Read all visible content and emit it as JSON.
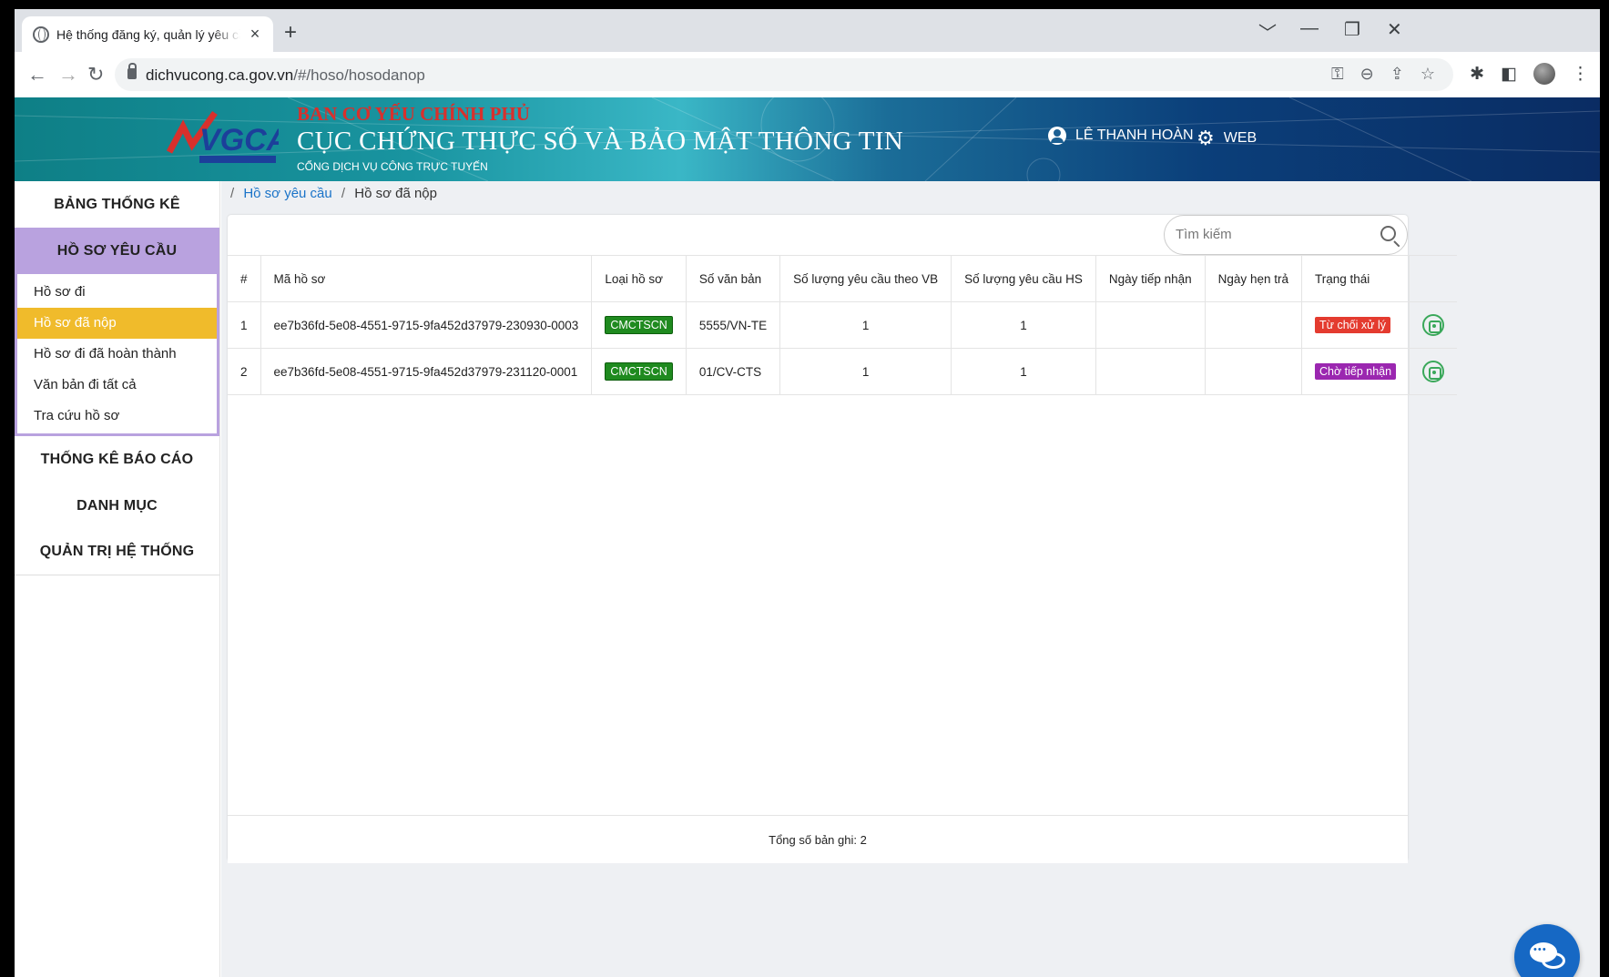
{
  "browser": {
    "tab_title": "Hệ thống đăng ký, quản lý yêu cầu",
    "tab_close": "×",
    "new_tab": "+",
    "url_host": "dichvucong.ca.gov.vn",
    "url_path": "/#/hoso/hosodanop",
    "win_controls": [
      "﹀",
      "—",
      "❐",
      "✕"
    ]
  },
  "header": {
    "logo_text": "VGCA",
    "org_top": "BAN CƠ YẾU CHÍNH PHỦ",
    "org_main": "CỤC CHỨNG THỰC SỐ VÀ BẢO MẬT THÔNG TIN",
    "org_sub": "CỔNG DỊCH VỤ CÔNG TRỰC TUYẾN",
    "user_name": "LÊ THANH HOÀN",
    "web_label": "WEB"
  },
  "sidebar": {
    "dashboard": "BẢNG THỐNG KÊ",
    "requests": "HỒ SƠ YÊU CẦU",
    "items": [
      "Hồ sơ đi",
      "Hồ sơ đã nộp",
      "Hồ sơ đi đã hoàn thành",
      "Văn bản đi tất cả",
      "Tra cứu hồ sơ"
    ],
    "reports": "THỐNG KÊ BÁO CÁO",
    "catalog": "DANH MỤC",
    "admin": "QUẢN TRỊ HỆ THỐNG"
  },
  "breadcrumb": {
    "sep": "/",
    "parent": "Hồ sơ yêu cầu",
    "current": "Hồ sơ đã nộp"
  },
  "search": {
    "placeholder": "Tìm kiếm"
  },
  "table": {
    "headers": [
      "#",
      "Mã hồ sơ",
      "Loại hồ sơ",
      "Số văn bản",
      "Số lượng yêu cầu theo VB",
      "Số lượng yêu cầu HS",
      "Ngày tiếp nhận",
      "Ngày hẹn trả",
      "Trạng thái",
      ""
    ],
    "rows": [
      {
        "index": "1",
        "code": "ee7b36fd-5e08-4551-9715-9fa452d37979-230930-0003",
        "type": "CMCTSCN",
        "doc_no": "5555/VN-TE",
        "qty_vb": "1",
        "qty_hs": "1",
        "received": "",
        "due": "",
        "status": "Từ chối xử lý",
        "status_color": "#e43b2f"
      },
      {
        "index": "2",
        "code": "ee7b36fd-5e08-4551-9715-9fa452d37979-231120-0001",
        "type": "CMCTSCN",
        "doc_no": "01/CV-CTS",
        "qty_vb": "1",
        "qty_hs": "1",
        "received": "",
        "due": "",
        "status": "Chờ tiếp nhận",
        "status_color": "#9b27b0"
      }
    ],
    "total": "Tổng số bản ghi: 2"
  },
  "colors": {
    "accent_purple": "#b9a2df",
    "active_yellow": "#f0bb2b",
    "link_blue": "#1a73c8",
    "chat_blue": "#1668c4"
  }
}
